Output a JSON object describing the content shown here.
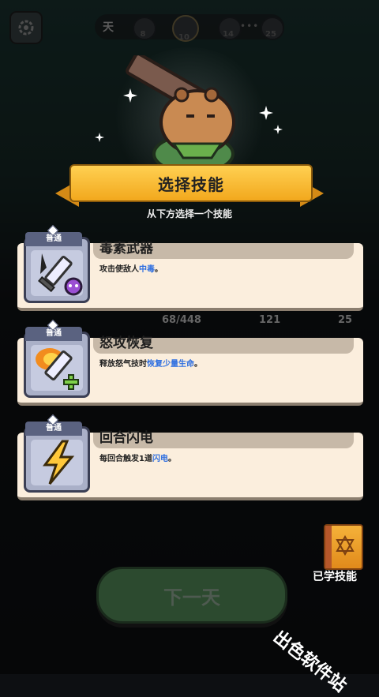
{
  "colors": {
    "accent": "#f2a81d",
    "highlight": "#2f6fe0",
    "card_bg": "#fbeedd"
  },
  "hud": {
    "day_label": "天",
    "days": [
      "8",
      "10",
      "14",
      "25"
    ],
    "dots": "•••"
  },
  "dialog": {
    "title": "选择技能",
    "subtitle": "从下方选择一个技能"
  },
  "skills": [
    {
      "tag": "普通",
      "name": "毒素武器",
      "desc_pre": "攻击使敌人",
      "desc_hl": "中毒",
      "desc_post": "。",
      "icon": "poison-sword-icon"
    },
    {
      "tag": "普通",
      "name": "怒攻恢复",
      "desc_pre": "释放怒气技时",
      "desc_hl": "恢复少量生命",
      "desc_post": "。",
      "icon": "flame-sword-heal-icon"
    },
    {
      "tag": "普通",
      "name": "回合闪电",
      "desc_pre": "每回合触发1道",
      "desc_hl": "闪电",
      "desc_post": "。",
      "icon": "lightning-icon"
    }
  ],
  "background_stats": {
    "hp": "68/448",
    "attack": "121",
    "defense": "25"
  },
  "bottom": {
    "next_day": "下一天",
    "learned_skills": "已学技能"
  },
  "watermark": "出色软件站"
}
